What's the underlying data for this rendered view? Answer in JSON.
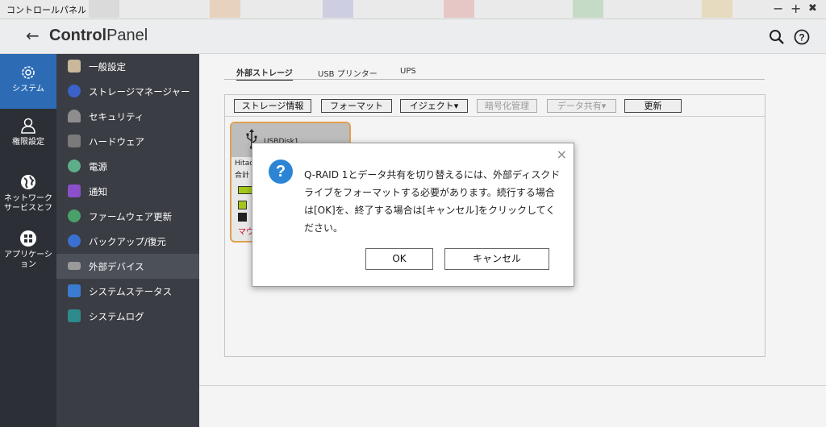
{
  "window": {
    "title": "コントロールパネル",
    "minimize": "−",
    "maximize": "+",
    "close": "✖"
  },
  "header": {
    "back": "←",
    "title_bold": "Control",
    "title_rest": "Panel"
  },
  "rail": [
    {
      "label": "システム",
      "icon": "gear-icon",
      "active": true
    },
    {
      "label": "権限設定",
      "icon": "user-icon",
      "active": false
    },
    {
      "label": "ネットワーク サービスとフ",
      "icon": "globe-icon",
      "active": false
    },
    {
      "label": "アプリケーション",
      "icon": "apps-grid-icon",
      "active": false
    }
  ],
  "submenu": [
    {
      "label": "一般設定",
      "icon": "general-settings-icon",
      "color": "#c9b99a"
    },
    {
      "label": "ストレージマネージャー",
      "icon": "storage-icon",
      "color": "#3a62c9"
    },
    {
      "label": "セキュリティ",
      "icon": "lock-icon",
      "color": "#8d8d8d"
    },
    {
      "label": "ハードウェア",
      "icon": "hardware-icon",
      "color": "#7a7a7a"
    },
    {
      "label": "電源",
      "icon": "power-icon",
      "color": "#5fae8a"
    },
    {
      "label": "通知",
      "icon": "notification-icon",
      "color": "#8a4fc9"
    },
    {
      "label": "ファームウェア更新",
      "icon": "firmware-icon",
      "color": "#4aa06a"
    },
    {
      "label": "バックアップ/復元",
      "icon": "backup-icon",
      "color": "#3b6fd1"
    },
    {
      "label": "外部デバイス",
      "icon": "external-device-icon",
      "color": "#9a9a9a",
      "active": true
    },
    {
      "label": "システムステータス",
      "icon": "system-status-icon",
      "color": "#3b7bd1"
    },
    {
      "label": "システムログ",
      "icon": "system-log-icon",
      "color": "#2e8b8b"
    }
  ],
  "tabs": [
    "外部ストレージ",
    "USB プリンター",
    "UPS"
  ],
  "toolbar": {
    "storage_info": "ストレージ情報",
    "format": "フォーマット",
    "eject": "イジェクト▾",
    "encryption": "暗号化管理",
    "data_share": "データ共有▾",
    "refresh": "更新"
  },
  "device_card": {
    "name": "USBDisk1",
    "line1": "Hitac",
    "line2": "合計",
    "red_text": "マウ"
  },
  "dialog": {
    "message": "Q-RAID 1とデータ共有を切り替えるには、外部ディスクドライブをフォーマットする必要があります。続行する場合は[OK]を、終了する場合は[キャンセル]をクリックしてください。",
    "ok": "OK",
    "cancel": "キャンセル",
    "close": "×",
    "icon": "?"
  }
}
